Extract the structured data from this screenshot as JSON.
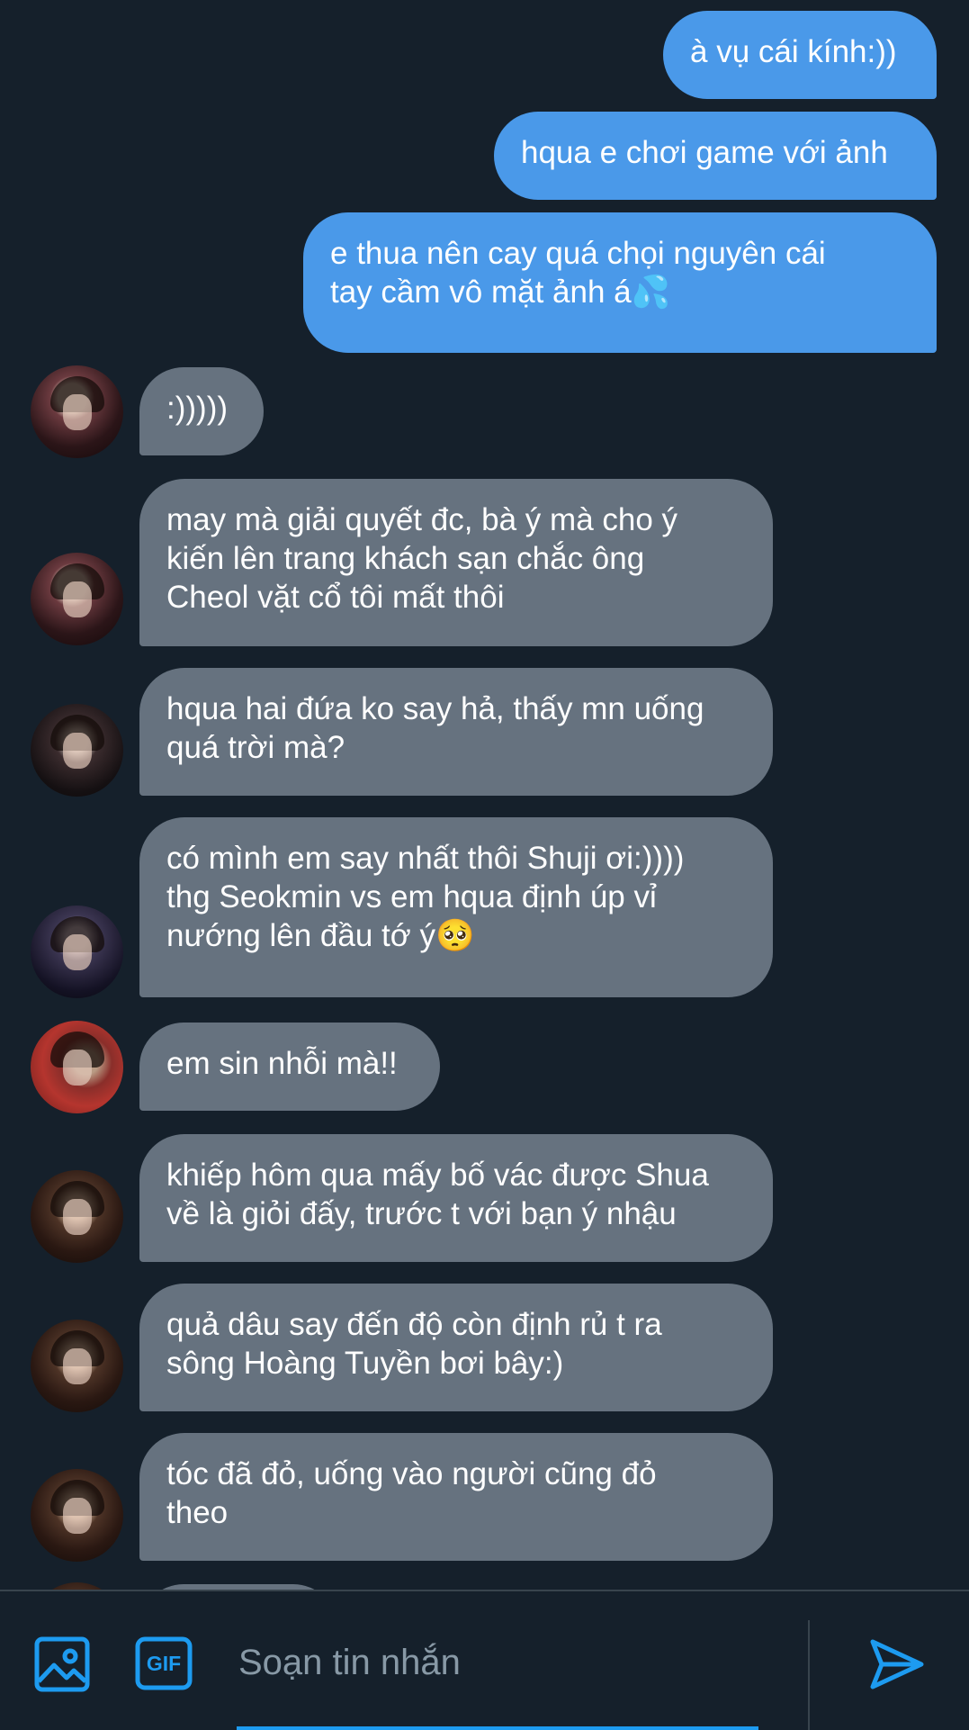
{
  "messages": [
    {
      "dir": "out",
      "text": "à vụ cái kính:))"
    },
    {
      "dir": "out",
      "text": "hqua e chơi game với ảnh"
    },
    {
      "dir": "out",
      "text": "e thua nên cay quá chọi nguyên cái\ntay cầm vô mặt ảnh á💦"
    },
    {
      "dir": "in",
      "text": ":)))))",
      "avatar": "avatar-user-1"
    },
    {
      "dir": "in",
      "text": "may mà giải quyết đc, bà ý mà cho ý\nkiến lên trang khách sạn chắc ông\nCheol vặt cổ tôi mất thôi",
      "avatar": "avatar-user-1"
    },
    {
      "dir": "in",
      "text": "hqua hai đứa ko say hả, thấy mn uống\nquá trời mà?",
      "avatar": "avatar-user-2"
    },
    {
      "dir": "in",
      "text": "có mình em say nhất thôi Shuji ơi:))))\nthg Seokmin vs em hqua định úp vỉ\nnướng lên đầu tớ ý🥺",
      "avatar": "avatar-user-3"
    },
    {
      "dir": "in",
      "text": "em sin nhỗi mà!!",
      "avatar": "avatar-user-4"
    },
    {
      "dir": "in",
      "text": "khiếp hôm qua mấy bố vác được Shua\nvề là giỏi đấy, trước t với bạn ý nhậu",
      "avatar": "avatar-user-5"
    },
    {
      "dir": "in",
      "text": "quả dâu say đến độ còn định rủ t ra\nsông Hoàng Tuyền bơi bây:)",
      "avatar": "avatar-user-5"
    },
    {
      "dir": "in",
      "text": "tóc đã đỏ, uống vào người cũng đỏ\ntheo",
      "avatar": "avatar-user-5"
    }
  ],
  "composer": {
    "placeholder": "Soạn tin nhắn",
    "image_icon": "image-icon",
    "gif_label": "GIF",
    "send_icon": "send-icon"
  },
  "colors": {
    "background": "#15202b",
    "outgoing_bubble": "#4a99e9",
    "incoming_bubble": "#66727f",
    "accent": "#1d9bf0"
  }
}
